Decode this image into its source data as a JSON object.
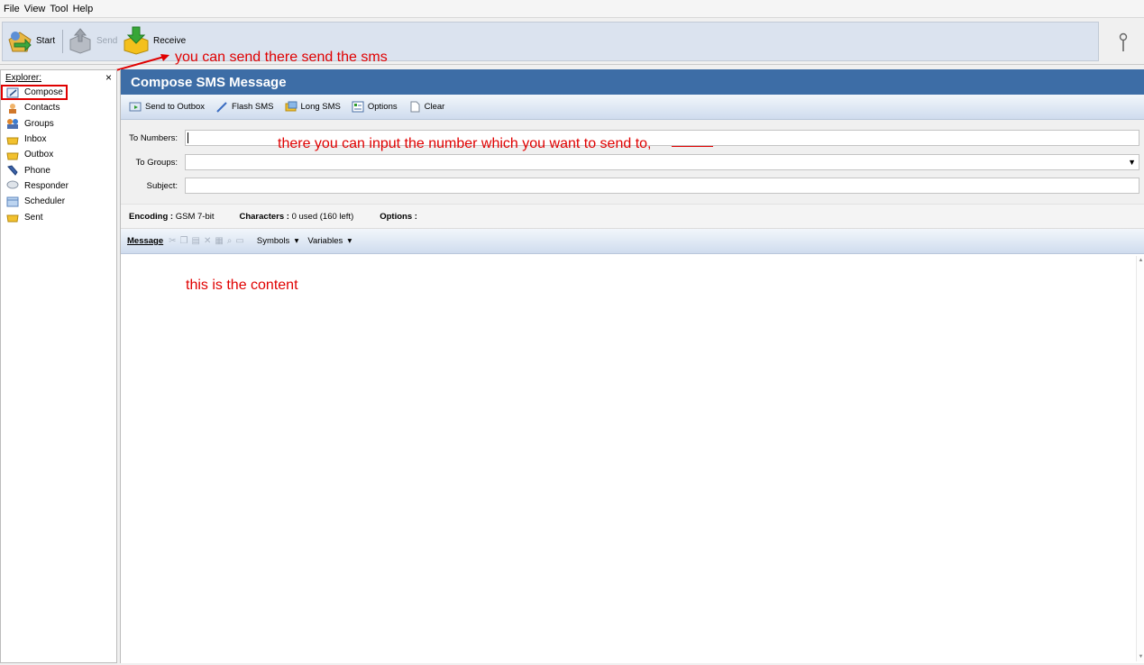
{
  "menubar": {
    "items": [
      "File",
      "View",
      "Tool",
      "Help"
    ]
  },
  "toolbar": {
    "start_label": "Start",
    "send_label": "Send",
    "receive_label": "Receive"
  },
  "annotations": {
    "send_note": "you can send there send the sms",
    "number_note": "there you can input the number which you want to send to,",
    "content_note": "this is the content"
  },
  "sidebar": {
    "header": "Explorer:",
    "close": "×",
    "items": [
      {
        "label": "Compose",
        "icon": "compose-icon"
      },
      {
        "label": "Contacts",
        "icon": "contacts-icon"
      },
      {
        "label": "Groups",
        "icon": "groups-icon"
      },
      {
        "label": "Inbox",
        "icon": "inbox-icon"
      },
      {
        "label": "Outbox",
        "icon": "outbox-icon"
      },
      {
        "label": "Phone",
        "icon": "phone-icon"
      },
      {
        "label": "Responder",
        "icon": "responder-icon"
      },
      {
        "label": "Scheduler",
        "icon": "scheduler-icon"
      },
      {
        "label": "Sent",
        "icon": "sent-icon"
      }
    ]
  },
  "compose": {
    "title": "Compose SMS Message",
    "actions": {
      "send_to_outbox": "Send to Outbox",
      "flash_sms": "Flash SMS",
      "long_sms": "Long SMS",
      "options": "Options",
      "clear": "Clear"
    },
    "fields": {
      "to_numbers_label": "To Numbers:",
      "to_groups_label": "To Groups:",
      "subject_label": "Subject:",
      "to_numbers_value": "",
      "to_groups_value": "",
      "subject_value": ""
    },
    "encoding": {
      "encoding_label": "Encoding :",
      "encoding_value": "GSM 7-bit",
      "characters_label": "Characters :",
      "characters_value": "0 used (160 left)",
      "options_label": "Options :"
    },
    "message": {
      "label": "Message",
      "symbols": "Symbols",
      "variables": "Variables",
      "content": ""
    }
  },
  "colors": {
    "title_bar": "#3d6da6",
    "annotation": "#e00000",
    "toolbar_bg": "#dbe3ef"
  }
}
